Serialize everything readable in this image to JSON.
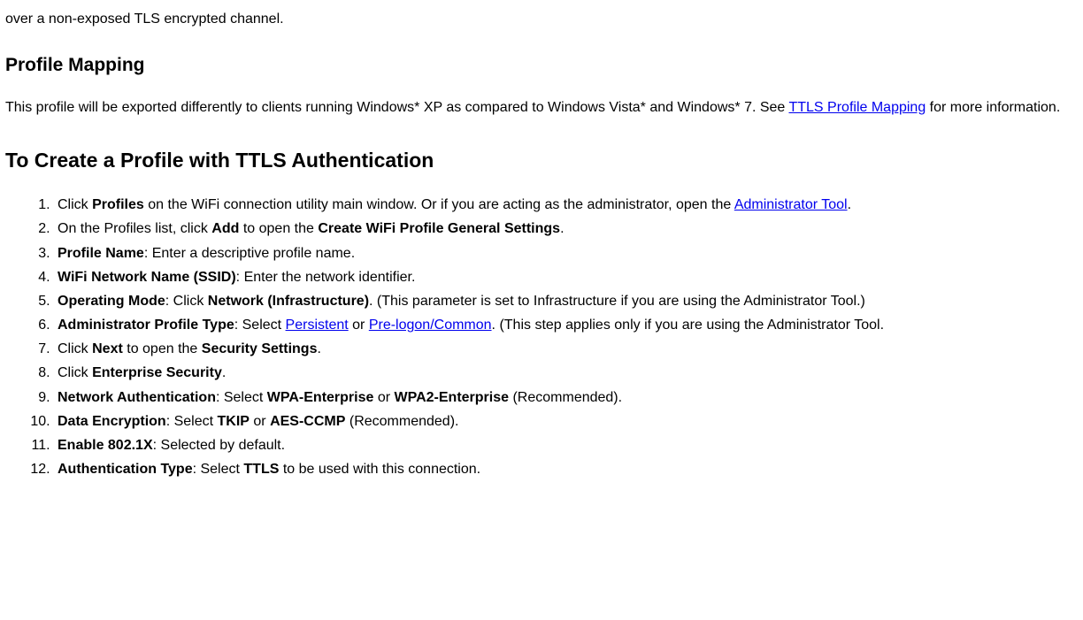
{
  "intro_snippet": "over a non-exposed TLS encrypted channel.",
  "heading_profile_mapping": "Profile Mapping",
  "profile_mapping_p1_a": "This profile will be exported differently to clients running Windows* XP as compared to Windows Vista* and Windows* 7. See ",
  "profile_mapping_link": "TTLS Profile Mapping",
  "profile_mapping_p1_b": " for more information.",
  "heading_create": "To Create a Profile with TTLS Authentication",
  "li1_a": "Click ",
  "li1_b_bold": "Profiles",
  "li1_c": " on the WiFi connection utility main window. Or if you are acting as the administrator, open the ",
  "li1_link": "Administrator Tool",
  "li1_d": ".",
  "li2_a": "On the Profiles list, click ",
  "li2_b_bold": "Add",
  "li2_c": " to open the ",
  "li2_d_bold": "Create WiFi Profile General Settings",
  "li2_e": ".",
  "li3_a_bold": "Profile Name",
  "li3_b": ": Enter a descriptive profile name.",
  "li4_a_bold": "WiFi Network Name (SSID)",
  "li4_b": ": Enter the network identifier.",
  "li5_a_bold": "Operating Mode",
  "li5_b": ": Click ",
  "li5_c_bold": "Network (Infrastructure)",
  "li5_d": ". (This parameter is set to Infrastructure if you are using the Administrator Tool.)",
  "li6_a_bold": "Administrator Profile Type",
  "li6_b": ": Select ",
  "li6_link1": "Persistent",
  "li6_c": " or ",
  "li6_link2": "Pre-logon/Common",
  "li6_d": ". (This step applies only if you are using the Administrator Tool.",
  "li7_a": "Click ",
  "li7_b_bold": "Next",
  "li7_c": " to open the ",
  "li7_d_bold": "Security Settings",
  "li7_e": ".",
  "li8_a": "Click ",
  "li8_b_bold": "Enterprise Security",
  "li8_c": ".",
  "li9_a_bold": "Network Authentication",
  "li9_b": ": Select ",
  "li9_c_bold": "WPA-Enterprise",
  "li9_d": " or ",
  "li9_e_bold": "WPA2-Enterprise",
  "li9_f": " (Recommended).",
  "li10_a_bold": "Data Encryption",
  "li10_b": ": Select ",
  "li10_c_bold": "TKIP",
  "li10_d": " or ",
  "li10_e_bold": "AES-CCMP",
  "li10_f": " (Recommended).",
  "li11_a_bold": "Enable 802.1X",
  "li11_b": ": Selected by default.",
  "li12_a_bold": "Authentication Type",
  "li12_b": ": Select ",
  "li12_c_bold": "TTLS",
  "li12_d": " to be used with this connection."
}
